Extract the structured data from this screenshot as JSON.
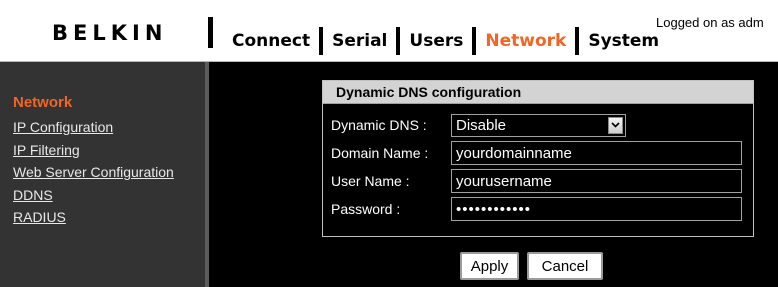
{
  "header": {
    "logo": "BELKIN",
    "nav": [
      {
        "label": "Connect",
        "active": false
      },
      {
        "label": "Serial",
        "active": false
      },
      {
        "label": "Users",
        "active": false
      },
      {
        "label": "Network",
        "active": true
      },
      {
        "label": "System",
        "active": false
      }
    ],
    "logged_on": "Logged on as adm"
  },
  "sidebar": {
    "heading": "Network",
    "items": [
      {
        "label": "IP Configuration"
      },
      {
        "label": "IP Filtering"
      },
      {
        "label": "Web Server Configuration"
      },
      {
        "label": "DDNS"
      },
      {
        "label": "RADIUS"
      }
    ]
  },
  "panel": {
    "title": "Dynamic DNS configuration",
    "fields": {
      "dynamic_dns": {
        "label": "Dynamic DNS :",
        "value": "Disable"
      },
      "domain_name": {
        "label": "Domain Name :",
        "value": "yourdomainname"
      },
      "user_name": {
        "label": "User Name :",
        "value": "yourusername"
      },
      "password": {
        "label": "Password :",
        "value": "••••••••••••"
      }
    }
  },
  "buttons": {
    "apply": "Apply",
    "cancel": "Cancel"
  },
  "colors": {
    "accent": "#f26522",
    "sidebar_bg": "#333333",
    "main_bg": "#000000",
    "panel_title_bg": "#d3d3d3"
  },
  "icons": {
    "select_arrow": "chevron-down-icon"
  }
}
